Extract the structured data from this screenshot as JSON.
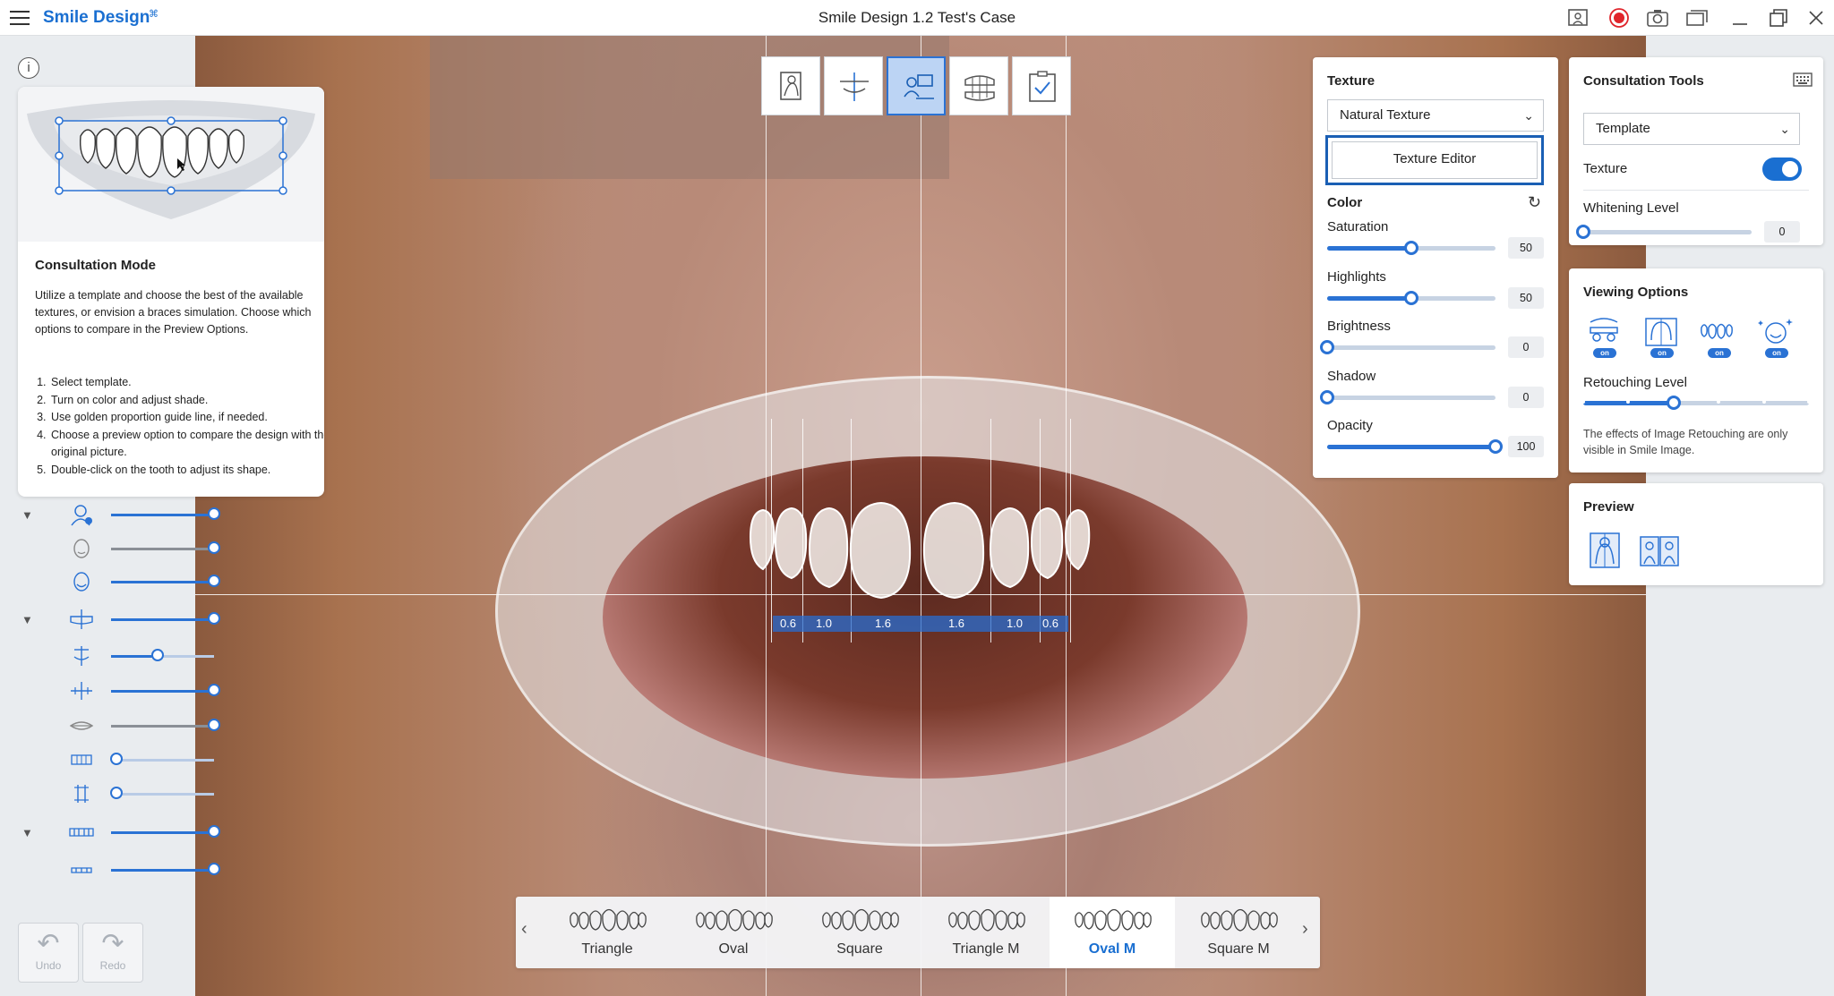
{
  "titlebar": {
    "app_title": "Smile Design",
    "window_title": "Smile Design 1.2 Test's Case",
    "icons": [
      "menu-icon",
      "screen-capture-icon",
      "record-icon",
      "camera-icon",
      "gallery-icon",
      "minimize-icon",
      "restore-icon",
      "close-icon"
    ],
    "record_color": "#e0242b"
  },
  "step_toolbar": {
    "steps": [
      "patient-photo-icon",
      "face-alignment-icon",
      "consultation-icon",
      "teeth-library-icon",
      "checklist-icon"
    ],
    "active_step": 2
  },
  "consultation_card": {
    "title": "Consultation Mode",
    "description": "Utilize a template and choose the best of the available textures, or envision a braces simulation. Choose which options to compare in the Preview Options.",
    "steps": [
      "Select template.",
      "Turn on color and adjust shade.",
      "Use golden proportion guide line, if needed.",
      "Choose a preview option to compare the design with the original picture.",
      "Double-click on the tooth to adjust its shape."
    ]
  },
  "left_sliders": [
    {
      "icon": "face-photo-icon",
      "value": 1.0,
      "caret": true
    },
    {
      "icon": "face-outline-icon",
      "value": 1.0,
      "gray": true
    },
    {
      "icon": "face-3d-icon",
      "value": 1.0
    },
    {
      "icon": "midline-guide-icon",
      "value": 1.0,
      "caret": true
    },
    {
      "icon": "vertical-guide-icon",
      "value": 0.45
    },
    {
      "icon": "horizontal-guide-icon",
      "value": 1.0
    },
    {
      "icon": "lip-line-icon",
      "value": 1.0,
      "gray": true
    },
    {
      "icon": "tooth-width-icon",
      "value": 0.05
    },
    {
      "icon": "tooth-length-icon",
      "value": 0.05
    },
    {
      "icon": "teeth-arch-icon",
      "value": 1.0,
      "caret": true
    },
    {
      "icon": "lower-arch-icon",
      "value": 1.0
    }
  ],
  "history": {
    "undo": "Undo",
    "redo": "Redo"
  },
  "golden_ratio": [
    "0.6",
    "1.0",
    "1.6",
    "1.6",
    "1.0",
    "0.6"
  ],
  "texture_panel": {
    "title": "Texture",
    "selected_texture": "Natural Texture",
    "editor_button": "Texture Editor",
    "color_title": "Color",
    "sliders": [
      {
        "label": "Saturation",
        "value": 50,
        "max": 100
      },
      {
        "label": "Highlights",
        "value": 50,
        "max": 100
      },
      {
        "label": "Brightness",
        "value": 0,
        "max": 100
      },
      {
        "label": "Shadow",
        "value": 0,
        "max": 100
      },
      {
        "label": "Opacity",
        "value": 100,
        "max": 100
      }
    ]
  },
  "consultation_tools": {
    "title": "Consultation Tools",
    "template_select": "Template",
    "texture_label": "Texture",
    "texture_on": true,
    "whitening_label": "Whitening Level",
    "whitening_value": 0
  },
  "viewing_options": {
    "title": "Viewing Options",
    "options": [
      "braces-view-icon",
      "face-frame-view-icon",
      "teeth-view-icon",
      "sparkle-face-view-icon"
    ],
    "on_label": "on",
    "retouching_label": "Retouching Level",
    "retouching_level": 0.4,
    "note": "The effects of Image Retouching are only visible in Smile Image."
  },
  "preview": {
    "title": "Preview",
    "options": [
      "single-preview-icon",
      "side-by-side-preview-icon"
    ]
  },
  "templates": {
    "items": [
      "Triangle",
      "Oval",
      "Square",
      "Triangle M",
      "Oval M",
      "Square M"
    ],
    "selected": 4
  },
  "colors": {
    "accent": "#2a72d4",
    "brand": "#1a6fd1"
  }
}
